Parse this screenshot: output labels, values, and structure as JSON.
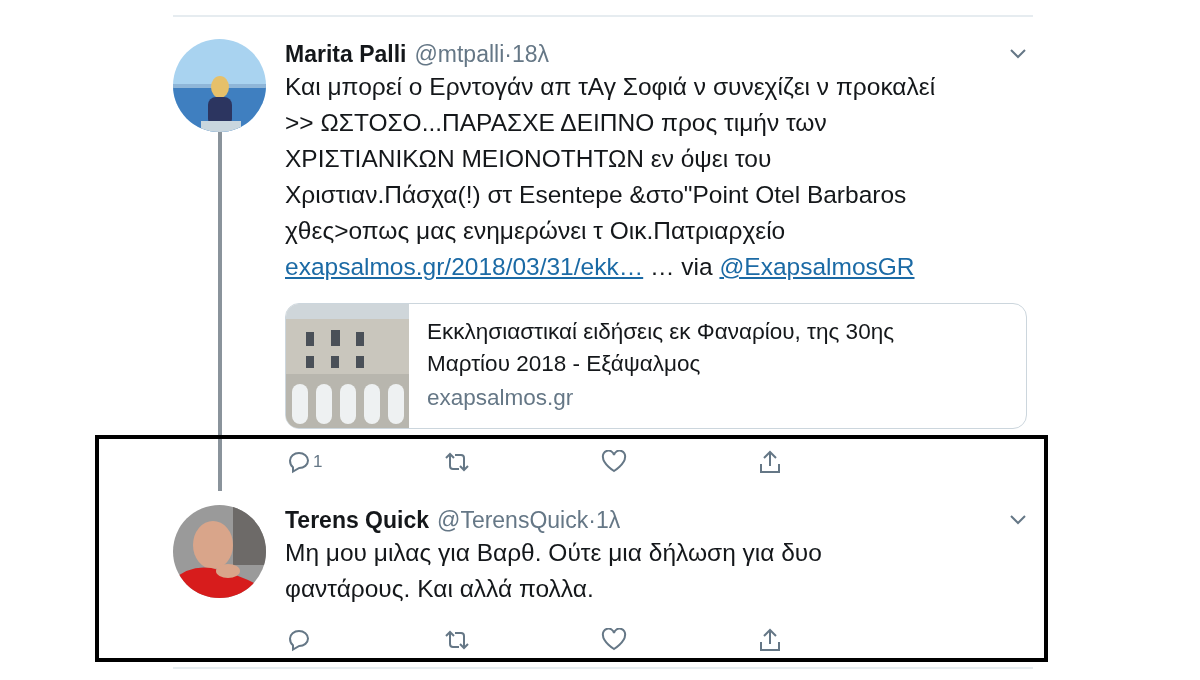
{
  "tweets": [
    {
      "name": "Marita Palli",
      "handle": "@mtpalli",
      "separator": "·",
      "time": "18λ",
      "connected": true,
      "body": [
        {
          "kind": "text",
          "text": "Και μπορεί ο Ερντογάν απ τΑγ Σοφιά ν συνεχίζει ν προκαλεί\n>> ΩΣΤΟΣΟ...ΠΑΡΑΣΧΕ ΔΕΙΠΝΟ προς τιμήν των\nΧΡΙΣΤΙΑΝΙΚΩΝ ΜΕΙΟΝΟΤΗΤΩΝ εν όψει του\nΧριστιαν.Πάσχα(!) στ Esentepe &στο\"Point Otel Barbaros\nχθες>οπως μας ενημερώνει τ Οικ.Πατριαρχείο\n"
        },
        {
          "kind": "link",
          "text": "exapsalmos.gr/2018/03/31/ekk…"
        },
        {
          "kind": "text",
          "text": " … via "
        },
        {
          "kind": "link",
          "text": "@ExapsalmosGR"
        }
      ],
      "card": {
        "title": "Εκκλησιαστικαί ειδήσεις εκ Φαναρίου, της 30ης\nΜαρτίου 2018 - Εξάψαλμος",
        "domain": "exapsalmos.gr"
      },
      "actions": [
        {
          "kind": "reply",
          "count": "1"
        },
        {
          "kind": "retweet"
        },
        {
          "kind": "like"
        },
        {
          "kind": "share"
        }
      ]
    },
    {
      "name": "Terens Quick",
      "handle": "@TerensQuick",
      "separator": "·",
      "time": "1λ",
      "connected": false,
      "body": [
        {
          "kind": "text",
          "text": "Μη μου μιλας για Βαρθ. Ούτε μια δήλωση για δυο\nφαντάρους. Και αλλά πολλα."
        }
      ],
      "actions": [
        {
          "kind": "reply"
        },
        {
          "kind": "retweet"
        },
        {
          "kind": "like"
        },
        {
          "kind": "share"
        }
      ]
    }
  ]
}
